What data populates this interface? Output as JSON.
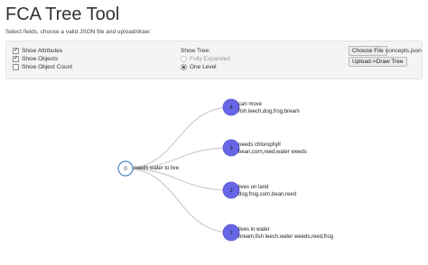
{
  "app": {
    "title": "FCA Tree Tool",
    "subtitle": "Select fields, choose a valid JSON file and upload/draw:"
  },
  "options": {
    "show_attributes": {
      "label": "Show Attributes",
      "checked": true
    },
    "show_objects": {
      "label": "Show Objects",
      "checked": true
    },
    "show_object_count": {
      "label": "Show Object Count",
      "checked": false
    }
  },
  "show_tree": {
    "label": "Show Tree:",
    "options": [
      {
        "label": "Fully Expanded",
        "selected": false
      },
      {
        "label": "One Level",
        "selected": true
      }
    ]
  },
  "file": {
    "choose_label": "Choose File",
    "filename": "concepts.json",
    "upload_label": "Upload->Draw Tree"
  },
  "tree": {
    "root": {
      "id": "0",
      "label": "needs water to live"
    },
    "children": [
      {
        "id": "4",
        "attr": "can move",
        "objects": "fish,leech,dog,frog,bream"
      },
      {
        "id": "3",
        "attr": "needs chlorophyll",
        "objects": "bean,corn,reed,water weeds"
      },
      {
        "id": "2",
        "attr": "lives on land",
        "objects": "dog,frog,corn,bean,reed"
      },
      {
        "id": "1",
        "attr": "lives in water",
        "objects": "bream,fish leech,water weeds,reed,frog"
      }
    ],
    "colors": {
      "root_stroke": "#4a86c5",
      "child_fill": "#6666e6",
      "link": "#cccccc"
    }
  }
}
